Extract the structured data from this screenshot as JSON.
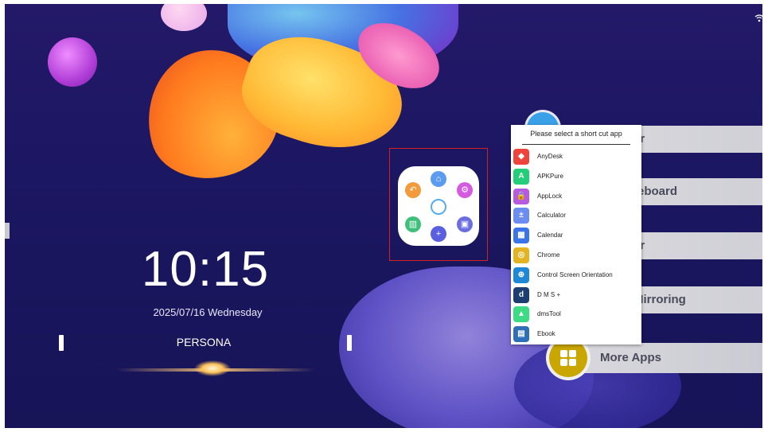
{
  "clock": {
    "time": "10:15",
    "date": "2025/07/16  Wednesday",
    "profile": "PERSONA"
  },
  "menu": {
    "items": [
      {
        "label": "er"
      },
      {
        "label": "teboard"
      },
      {
        "label": "er"
      },
      {
        "label": "Mirroring"
      }
    ],
    "more_apps": "More Apps"
  },
  "popup": {
    "title": "Please select a short cut app",
    "apps": [
      {
        "name": "AnyDesk",
        "icon": "anydesk-icon",
        "color": "#ef443b",
        "glyph": "◆"
      },
      {
        "name": "APKPure",
        "icon": "apkpure-icon",
        "color": "#24cd77",
        "glyph": "A"
      },
      {
        "name": "AppLock",
        "icon": "applock-icon",
        "color": "#b85adf",
        "glyph": "🔒"
      },
      {
        "name": "Calculator",
        "icon": "calculator-icon",
        "color": "#6d8cf0",
        "glyph": "±"
      },
      {
        "name": "Calendar",
        "icon": "calendar-icon",
        "color": "#3b74e8",
        "glyph": "▦"
      },
      {
        "name": "Chrome",
        "icon": "chrome-icon",
        "color": "#e4b322",
        "glyph": "◎"
      },
      {
        "name": "Control Screen Orientation",
        "icon": "orientation-icon",
        "color": "#1e88d6",
        "glyph": "⊕"
      },
      {
        "name": "D M S +",
        "icon": "dms-icon",
        "color": "#1c3e70",
        "glyph": "d"
      },
      {
        "name": "dmsTool",
        "icon": "dmstool-icon",
        "color": "#3ddc84",
        "glyph": "▲"
      },
      {
        "name": "Ebook",
        "icon": "ebook-icon",
        "color": "#2f6fb8",
        "glyph": "▤"
      }
    ]
  },
  "colors": {
    "highlight_frame": "#d62020",
    "background": "#1d1763"
  }
}
